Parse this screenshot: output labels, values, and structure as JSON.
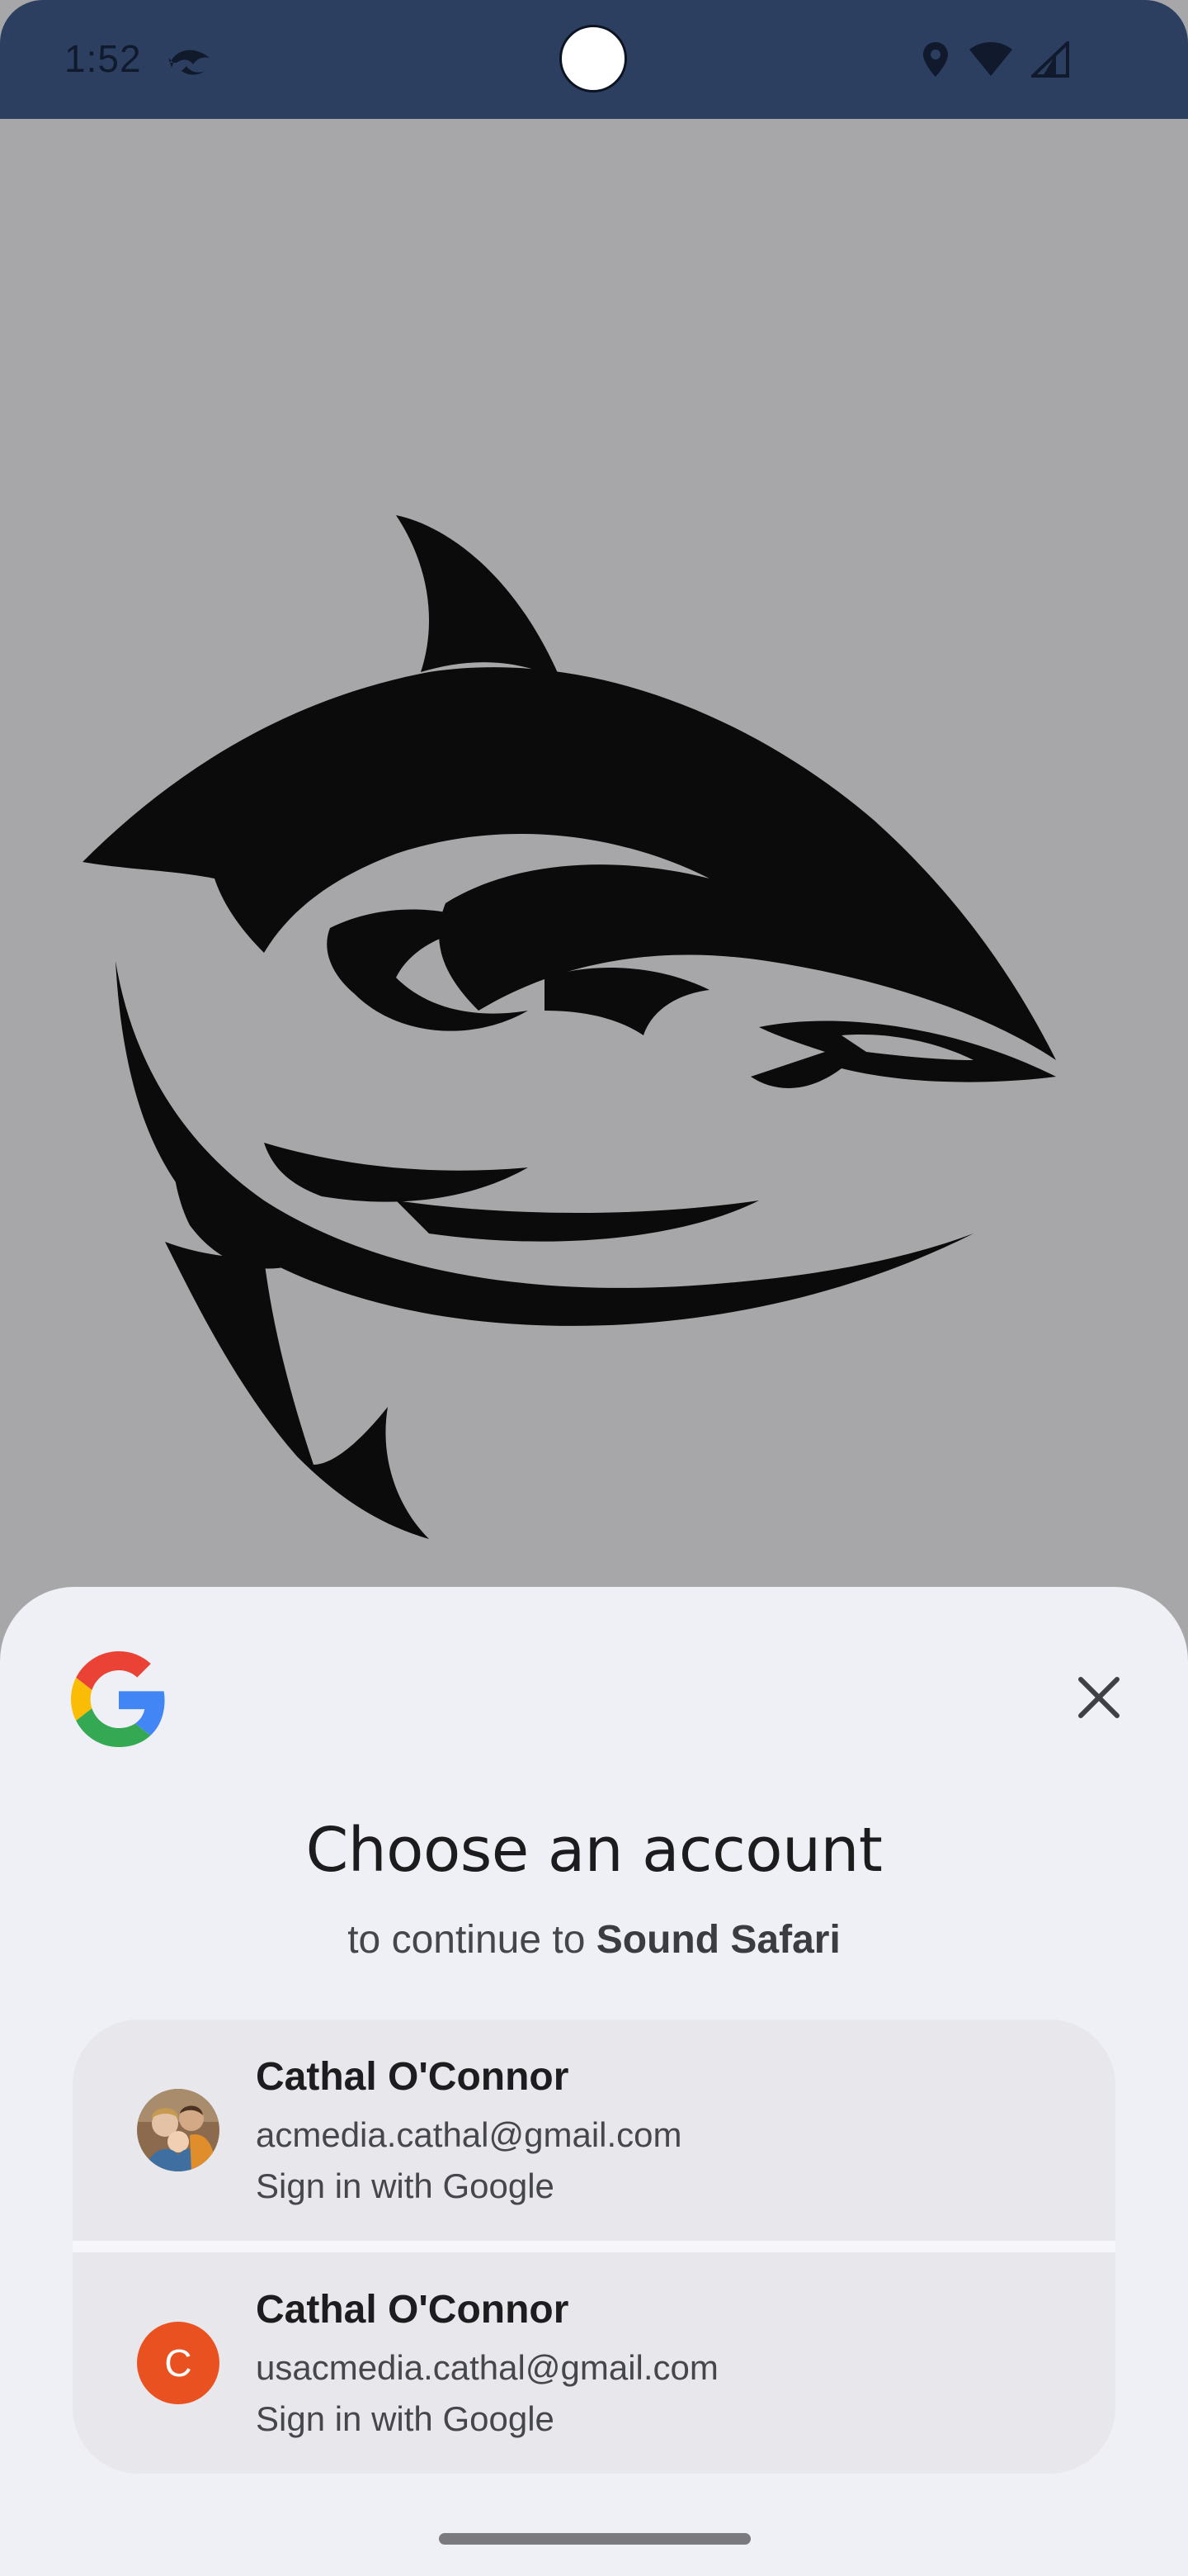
{
  "status_bar": {
    "time": "1:52",
    "app_icon": "shark-notification-icon",
    "icons": [
      "location-icon",
      "wifi-icon",
      "cell-signal-icon"
    ]
  },
  "splash": {
    "logo": "tribal-shark-logo",
    "background": "#a7a7a9"
  },
  "sheet": {
    "logo": "google-g-logo-icon",
    "close_icon": "close-icon",
    "title": "Choose an account",
    "subtitle_prefix": "to continue to ",
    "subtitle_app": "Sound Safari",
    "accounts": [
      {
        "name": "Cathal O'Connor",
        "email": "acmedia.cathal@gmail.com",
        "action": "Sign in with Google",
        "avatar": "photo-avatar"
      },
      {
        "name": "Cathal O'Connor",
        "email": "usacmedia.cathal@gmail.com",
        "action": "Sign in with Google",
        "avatar": "letter-avatar",
        "avatar_letter": "C",
        "avatar_color": "#ea5120"
      }
    ]
  },
  "colors": {
    "status_bar": "#2c3f60",
    "sheet_background": "#eff0f5",
    "account_card": "#e8e7ec"
  }
}
